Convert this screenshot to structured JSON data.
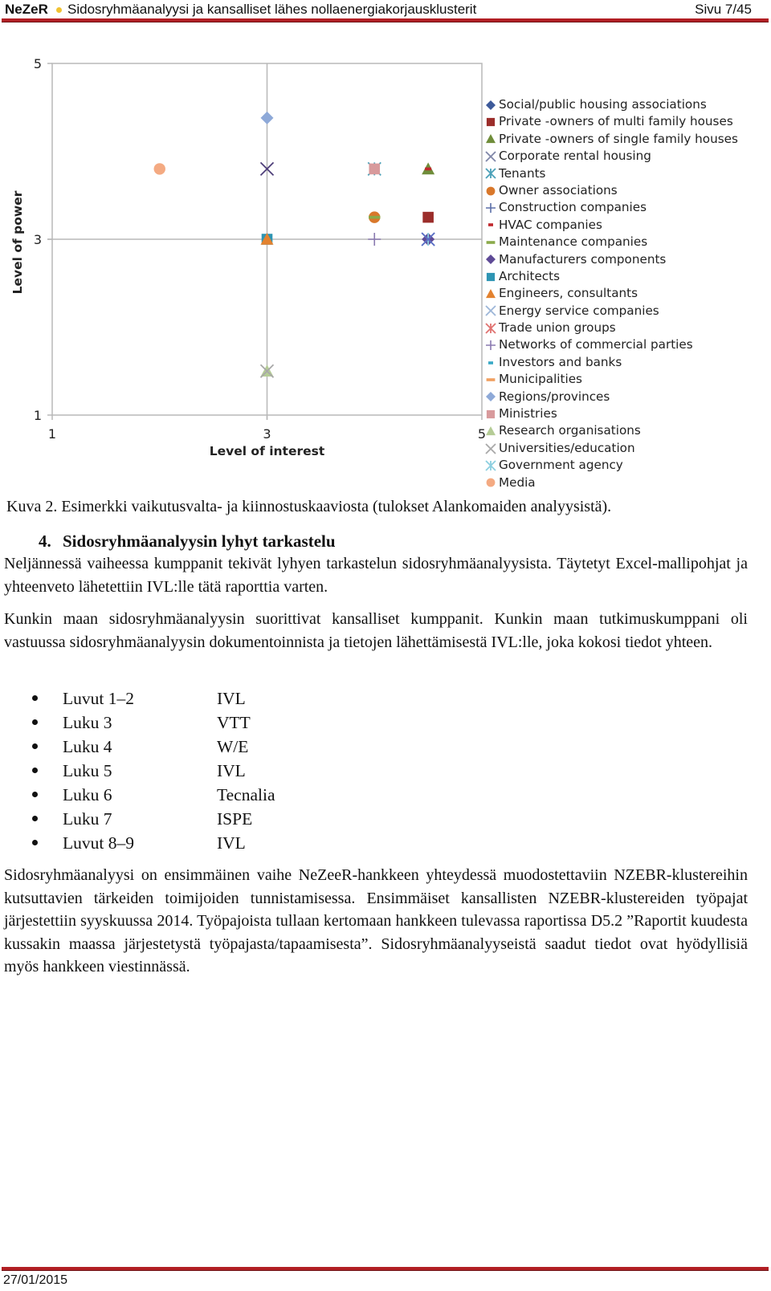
{
  "header": {
    "brand": "NeZeR",
    "title": "Sidosryhmäanalyysi ja kansalliset lähes nollaenergiakorjausklusterit",
    "page": "Sivu 7/45",
    "accent_color": "#b21f24",
    "dot_color": "#f1c232"
  },
  "chart_data": {
    "type": "scatter",
    "title": "",
    "xlabel": "Level of interest",
    "ylabel": "Level of power",
    "xlim": [
      1,
      5
    ],
    "ylim": [
      1,
      5
    ],
    "xticks": [
      "1",
      "3",
      "5"
    ],
    "yticks": [
      "1",
      "3",
      "5"
    ],
    "grid": "midlines at 3",
    "legend_position": "right",
    "series": [
      {
        "name": "Social/public housing associations",
        "marker": "diamond",
        "color": "#3d5a9a",
        "points": []
      },
      {
        "name": "Private -owners of multi family houses",
        "marker": "square",
        "color": "#9b2d2a",
        "points": [
          [
            4.5,
            3.25
          ]
        ]
      },
      {
        "name": "Private -owners of single family houses",
        "marker": "triangle",
        "color": "#6f8d3a",
        "points": [
          [
            4.5,
            3.8
          ]
        ]
      },
      {
        "name": "Corporate rental housing",
        "marker": "x",
        "color": "#7f86a8",
        "points": []
      },
      {
        "name": "Tenants",
        "marker": "asterisk",
        "color": "#4aa0b8",
        "points": [
          [
            4.0,
            3.8
          ]
        ]
      },
      {
        "name": "Owner associations",
        "marker": "circle",
        "color": "#d9782b",
        "points": [
          [
            4.0,
            3.25
          ]
        ]
      },
      {
        "name": "Construction companies",
        "marker": "plus",
        "color": "#5c6fa8",
        "points": []
      },
      {
        "name": "HVAC companies",
        "marker": "dash",
        "color": "#c0272d",
        "points": [
          [
            4.5,
            3.8
          ]
        ]
      },
      {
        "name": "Maintenance companies",
        "marker": "long-dash",
        "color": "#8aaa4a",
        "points": [
          [
            4.0,
            3.25
          ]
        ]
      },
      {
        "name": "Manufacturers components",
        "marker": "diamond",
        "color": "#5e4a96",
        "points": [
          [
            4.5,
            3.0
          ]
        ]
      },
      {
        "name": "Architects",
        "marker": "square",
        "color": "#2e95b3",
        "points": [
          [
            3.0,
            3.0
          ]
        ]
      },
      {
        "name": "Engineers, consultants",
        "marker": "triangle",
        "color": "#e3822f",
        "points": [
          [
            3.0,
            3.0
          ]
        ]
      },
      {
        "name": "Energy service companies",
        "marker": "x",
        "color": "#9db6d8",
        "points": []
      },
      {
        "name": "Trade union groups",
        "marker": "asterisk",
        "color": "#e07270",
        "points": []
      },
      {
        "name": "Networks of commercial parties",
        "marker": "plus",
        "color": "#8a7ab0",
        "points": [
          [
            4.0,
            3.0
          ]
        ]
      },
      {
        "name": "Investors and banks",
        "marker": "dash",
        "color": "#38a8c6",
        "points": []
      },
      {
        "name": "Municipalities",
        "marker": "long-dash",
        "color": "#f0a060",
        "points": []
      },
      {
        "name": "Regions/provinces",
        "marker": "diamond",
        "color": "#8ea9d8",
        "points": [
          [
            3.0,
            4.38
          ]
        ]
      },
      {
        "name": "Ministries",
        "marker": "square",
        "color": "#d89a9c",
        "points": [
          [
            4.0,
            3.8
          ]
        ]
      },
      {
        "name": "Research organisations",
        "marker": "triangle",
        "color": "#b5cc96",
        "points": [
          [
            3.0,
            1.5
          ]
        ]
      },
      {
        "name": "Universities/education",
        "marker": "x",
        "color": "#a8a8a8",
        "points": [
          [
            3.0,
            1.5
          ]
        ]
      },
      {
        "name": "Government agency",
        "marker": "asterisk",
        "color": "#8ccfe0",
        "points": [
          [
            4.5,
            3.0
          ]
        ]
      },
      {
        "name": "Media",
        "marker": "circle",
        "color": "#f4aa82",
        "points": [
          [
            2.0,
            3.8
          ]
        ]
      },
      {
        "name": "(unlabeled) dark X",
        "marker": "x",
        "color": "#4f3f7a",
        "points": [
          [
            3.0,
            3.8
          ]
        ]
      },
      {
        "name": "(unlabeled) blue X",
        "marker": "x",
        "color": "#5a6bc4",
        "points": [
          [
            4.5,
            3.0
          ]
        ]
      }
    ]
  },
  "caption": "Kuva 2. Esimerkki vaikutusvalta- ja kiinnostuskaaviosta (tulokset Alankomaiden analyysistä).",
  "section": {
    "number": "4.",
    "title": "Sidosryhmäanalyysin lyhyt tarkastelu"
  },
  "paragraphs": [
    "Neljännessä vaiheessa kumppanit tekivät lyhyen tarkastelun sidosryhmäanalyysista. Täytetyt Excel-mallipohjat ja yhteenveto lähetettiin IVL:lle tätä raporttia varten.",
    "Kunkin maan sidosryhmäanalyysin suorittivat kansalliset kumppanit. Kunkin maan tutkimuskumppani oli vastuussa sidosryhmäanalyysin dokumentoinnista ja tietojen lähettämisestä IVL:lle, joka kokosi tiedot yhteen.",
    "Sidosryhmäanalyysi on ensimmäinen vaihe NeZeeR-hankkeen yhteydessä muodostettaviin NZEBR-klustereihin kutsuttavien tärkeiden toimijoiden tunnistamisessa. Ensimmäiset kansallisten NZEBR-klustereiden työpajat järjestettiin syyskuussa 2014. Työpajoista tullaan kertomaan hankkeen tulevassa raportissa D5.2 ”Raportit kuudesta kussakin maassa järjestetystä työpajasta/tapaamisesta”. Sidosryhmäanalyyseistä saadut tiedot ovat hyödyllisiä myös hankkeen viestinnässä."
  ],
  "chapters": [
    {
      "chapter": "Luvut 1–2",
      "partner": "IVL"
    },
    {
      "chapter": "Luku 3",
      "partner": "VTT"
    },
    {
      "chapter": "Luku 4",
      "partner": "W/E"
    },
    {
      "chapter": "Luku 5",
      "partner": "IVL"
    },
    {
      "chapter": "Luku 6",
      "partner": "Tecnalia"
    },
    {
      "chapter": "Luku 7",
      "partner": "ISPE"
    },
    {
      "chapter": "Luvut 8–9",
      "partner": "IVL"
    }
  ],
  "footer": {
    "date": "27/01/2015"
  }
}
